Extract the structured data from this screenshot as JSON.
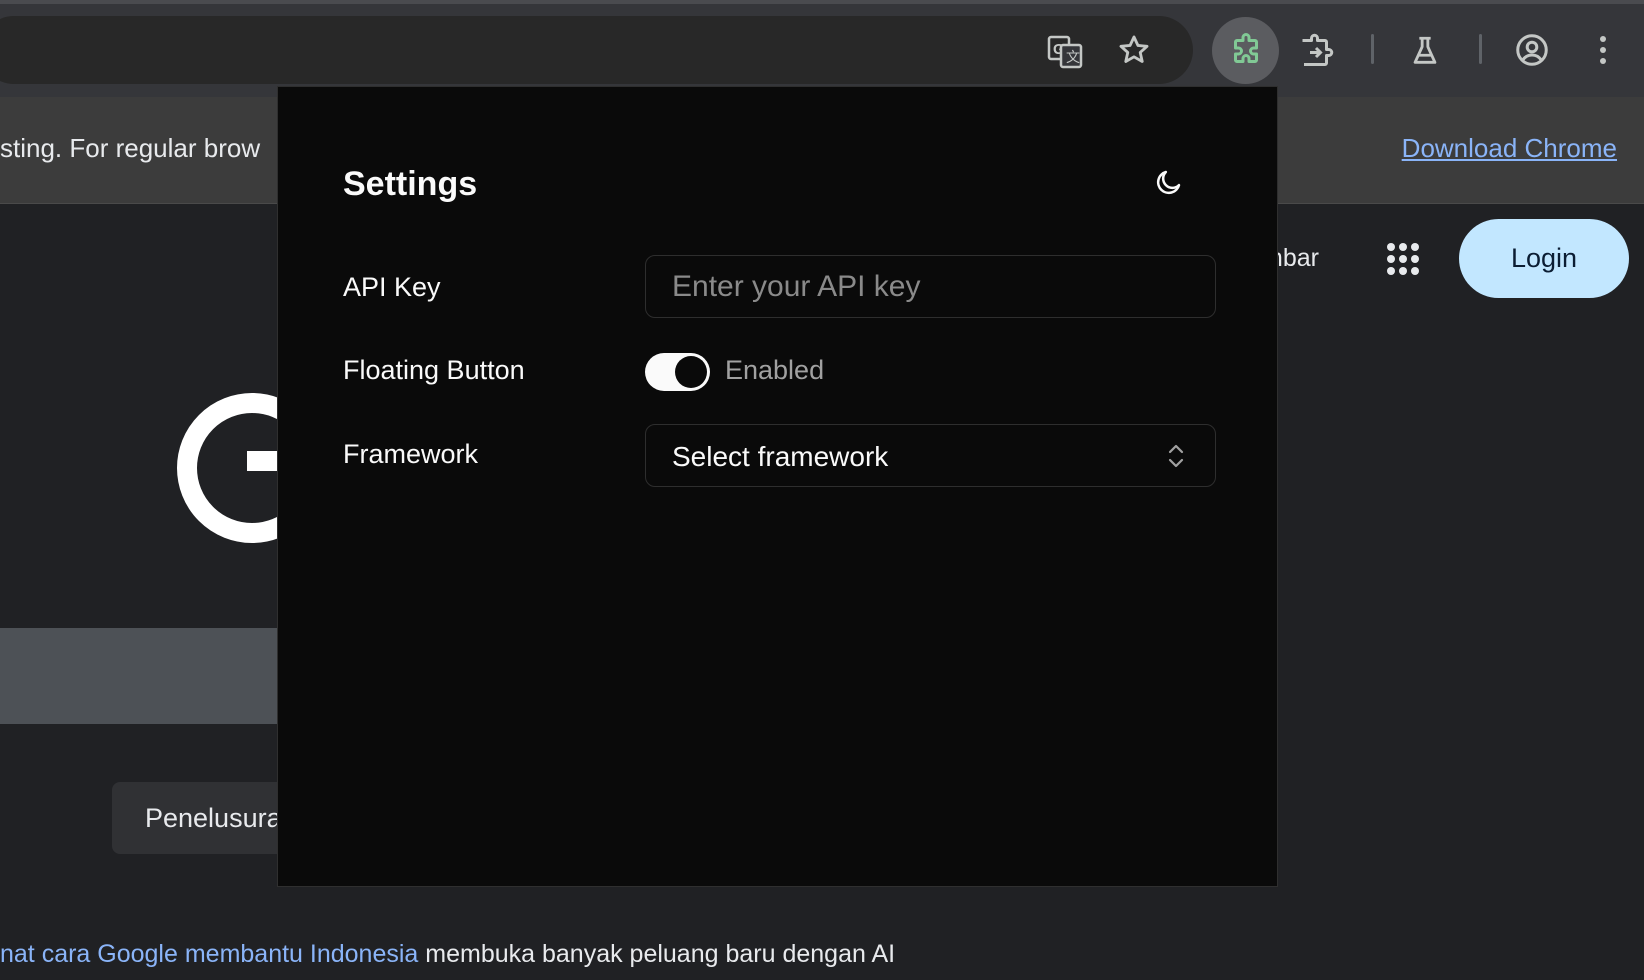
{
  "browser": {
    "infobar_text": "sting. For regular brow",
    "infobar_link": "Download Chrome",
    "icons": [
      "translate-icon",
      "bookmark-star-icon",
      "puzzle-extension-icon",
      "extensions-icon",
      "labs-flask-icon",
      "profile-icon",
      "menu-kebab-icon"
    ]
  },
  "page": {
    "nav_text": "mbar",
    "login_label": "Login",
    "search_button_label": "Penelusuran",
    "footer_link": "nat cara Google membantu Indonesia",
    "footer_text": " membuka banyak peluang baru dengan AI"
  },
  "popup": {
    "title": "Settings",
    "api_key": {
      "label": "API Key",
      "placeholder": "Enter your API key",
      "value": ""
    },
    "floating_button": {
      "label": "Floating Button",
      "state": "Enabled",
      "enabled": true
    },
    "framework": {
      "label": "Framework",
      "value": "Select framework"
    }
  },
  "colors": {
    "popup_bg": "#0a0a0a",
    "login_bg": "#c2e7ff",
    "link": "#8ab4f8",
    "active_extension": "#81c995"
  }
}
